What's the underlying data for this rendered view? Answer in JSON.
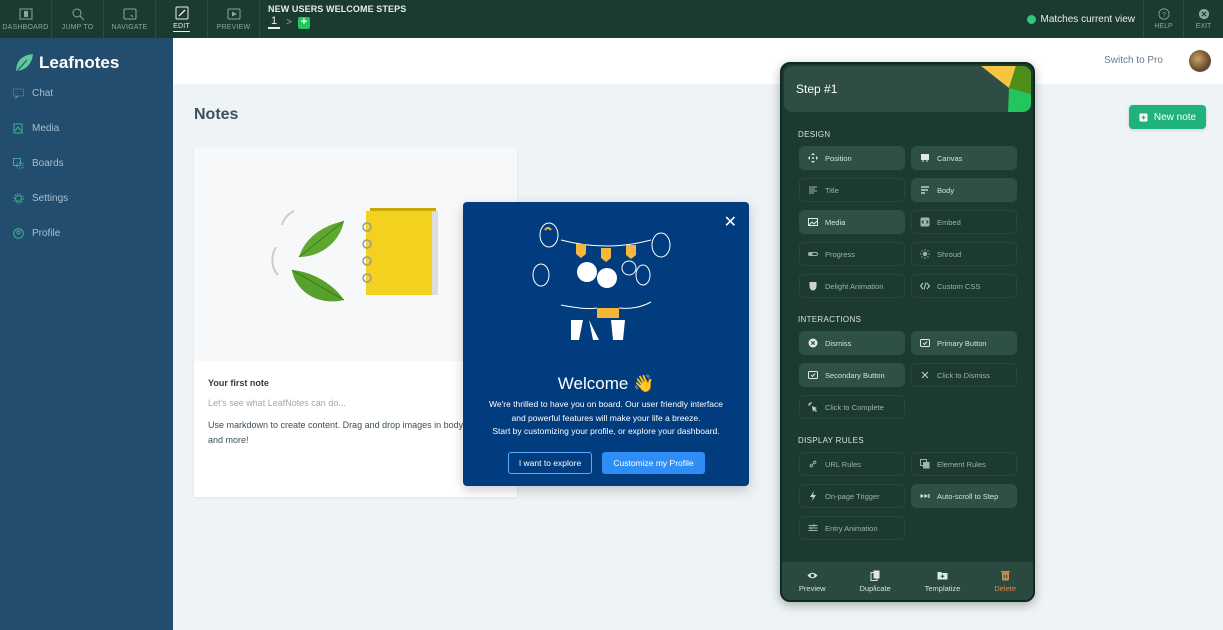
{
  "topbar": {
    "items": [
      {
        "label": "DASHBOARD",
        "icon": "dashboard-icon"
      },
      {
        "label": "JUMP TO",
        "icon": "search-icon"
      },
      {
        "label": "NAVIGATE",
        "icon": "navigate-icon"
      },
      {
        "label": "EDIT",
        "icon": "edit-icon",
        "active": true
      },
      {
        "label": "PREVIEW",
        "icon": "play-icon"
      }
    ],
    "flow_title": "NEW USERS WELCOME STEPS",
    "current_step": "1",
    "status": "Matches current view",
    "help_label": "HELP",
    "exit_label": "EXIT"
  },
  "sidebar": {
    "brand": "Leafnotes",
    "items": [
      {
        "label": "Chat",
        "icon": "chat-icon"
      },
      {
        "label": "Media",
        "icon": "media-icon"
      },
      {
        "label": "Boards",
        "icon": "boards-icon"
      },
      {
        "label": "Settings",
        "icon": "settings-icon"
      },
      {
        "label": "Profile",
        "icon": "profile-icon"
      }
    ]
  },
  "header": {
    "switch_pro": "Switch to Pro"
  },
  "main": {
    "title": "Notes",
    "new_note": "New note",
    "note": {
      "title": "Your first note",
      "subtitle": "Let's see what LeafNotes can do...",
      "body": "Use markdown to create content. Drag and drop images in body, link notes and more!"
    }
  },
  "modal": {
    "title": "Welcome 👋",
    "text_lines": [
      "We're thrilled to have you on board. Our user friendly interface",
      "and powerful features will make your life a breeze.",
      "Start by customizing your profile, or explore your dashboard."
    ],
    "secondary_button": "I want to explore",
    "primary_button": "Customize my Profile"
  },
  "panel": {
    "title": "Step #1",
    "sections": {
      "design": "DESIGN",
      "interactions": "INTERACTIONS",
      "display_rules": "DISPLAY RULES"
    },
    "design": [
      {
        "label": "Position",
        "on": true
      },
      {
        "label": "Canvas",
        "on": true
      },
      {
        "label": "Title",
        "on": false
      },
      {
        "label": "Body",
        "on": true
      },
      {
        "label": "Media",
        "on": true
      },
      {
        "label": "Embed",
        "on": false
      },
      {
        "label": "Progress",
        "on": false
      },
      {
        "label": "Shroud",
        "on": false
      },
      {
        "label": "Delight Animation",
        "on": false
      },
      {
        "label": "Custom CSS",
        "on": false
      }
    ],
    "interactions": [
      {
        "label": "Dismiss",
        "on": true
      },
      {
        "label": "Primary Button",
        "on": true
      },
      {
        "label": "Secondary Button",
        "on": true
      },
      {
        "label": "Click to Dismiss",
        "on": false
      },
      {
        "label": "Click to Complete",
        "on": false
      }
    ],
    "display_rules": [
      {
        "label": "URL Rules",
        "on": false
      },
      {
        "label": "Element Rules",
        "on": false
      },
      {
        "label": "On-page Trigger",
        "on": false
      },
      {
        "label": "Auto-scroll to Step",
        "on": true
      },
      {
        "label": "Entry Animation",
        "on": false
      }
    ],
    "footer": {
      "preview": "Preview",
      "duplicate": "Duplicate",
      "templatize": "Templatize",
      "delete": "Delete"
    }
  }
}
